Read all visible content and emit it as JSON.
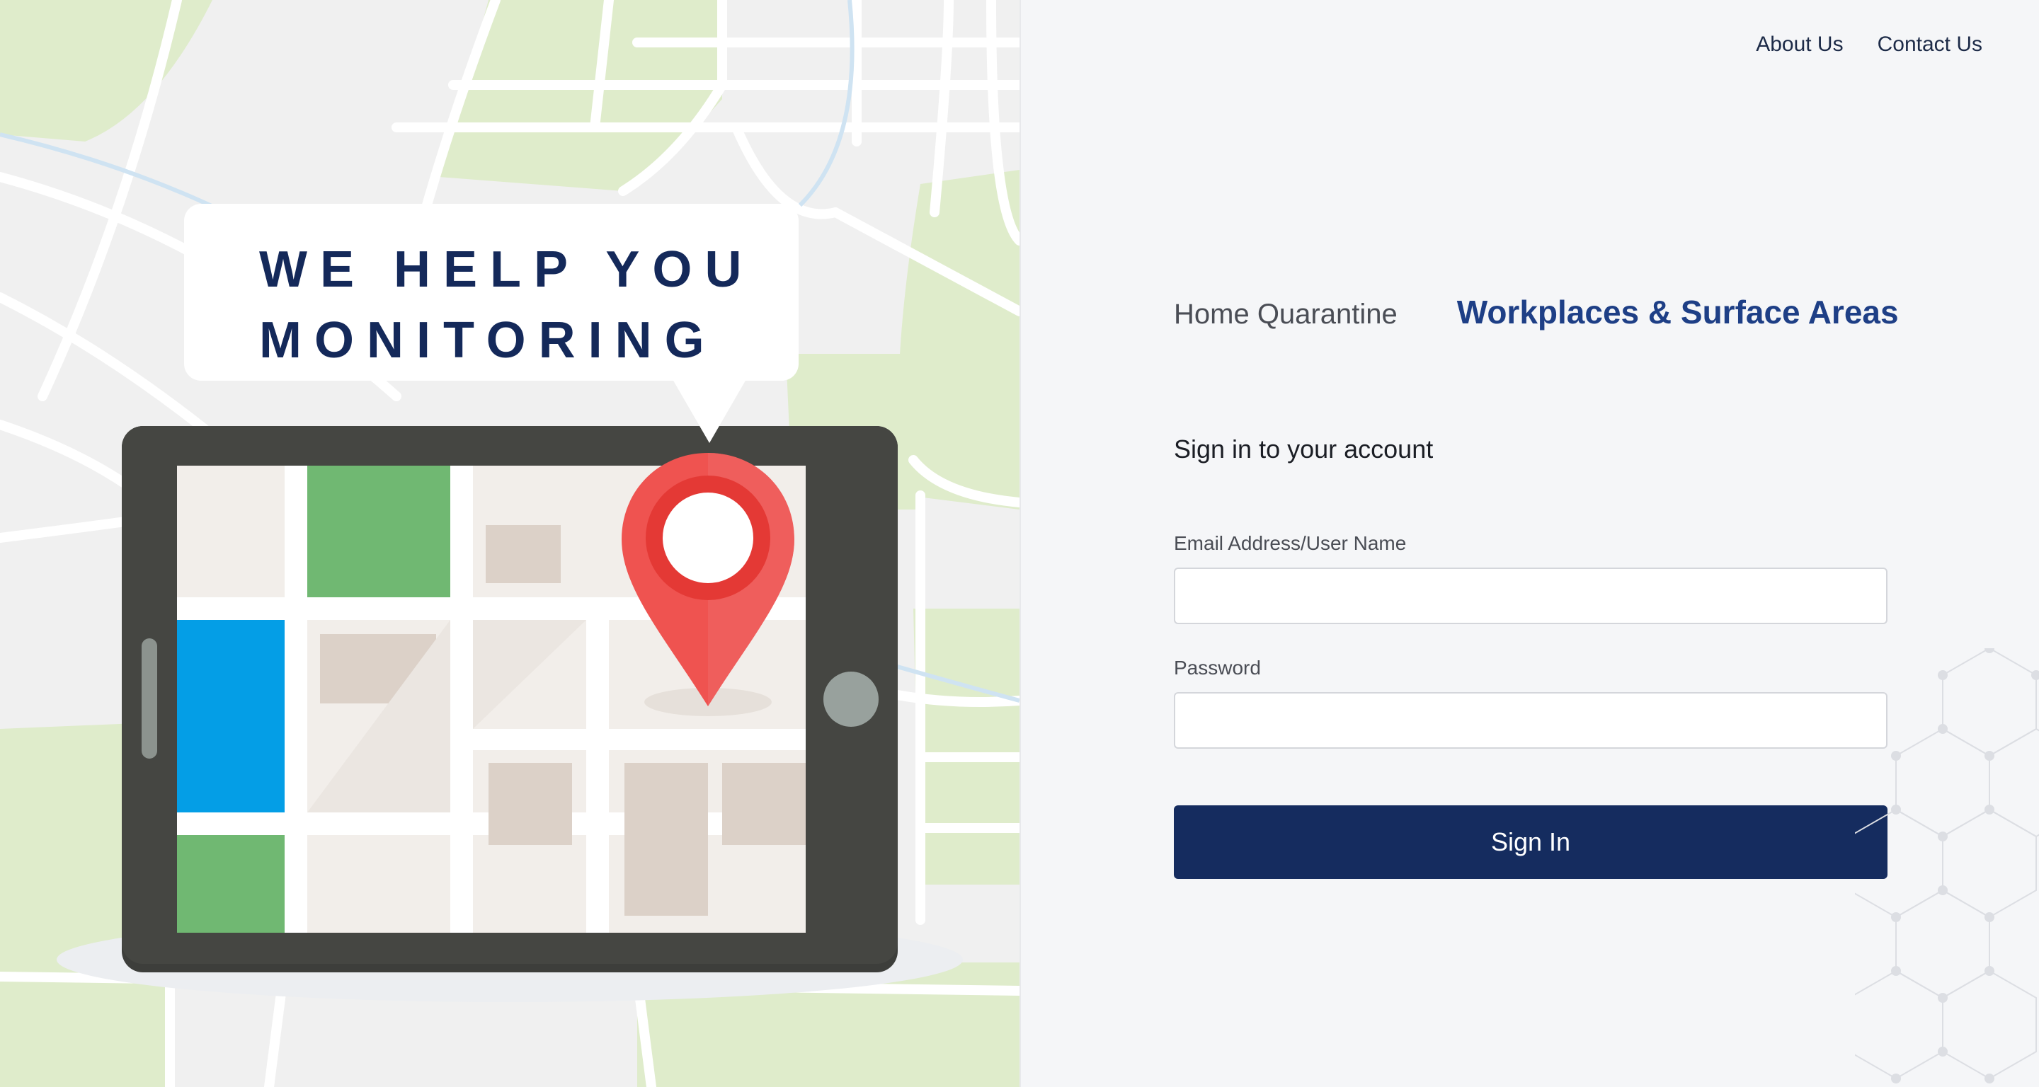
{
  "hero": {
    "line1": "WE HELP YOU",
    "line2": "MONITORING"
  },
  "nav": {
    "about": "About Us",
    "contact": "Contact Us"
  },
  "tabs": {
    "home_quarantine": "Home Quarantine",
    "workplaces": "Workplaces & Surface Areas",
    "active": "workplaces"
  },
  "form": {
    "title": "Sign in to your account",
    "email_label": "Email Address/User Name",
    "email_value": "",
    "password_label": "Password",
    "password_value": "",
    "submit_label": "Sign In"
  },
  "colors": {
    "brand_navy": "#152c5f",
    "active_tab": "#1e3f86",
    "map_green": "#dfeccb",
    "pin_red": "#ef5350",
    "tablet_body": "#3d3e3b",
    "block_blue": "#049ee6",
    "block_green": "#70b872"
  },
  "icons": {
    "location_pin": "location-pin-icon",
    "home_button": "tablet-home-button-icon"
  }
}
